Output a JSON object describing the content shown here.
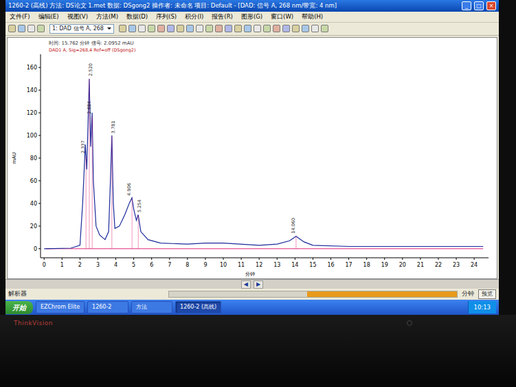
{
  "window": {
    "title": "1260-2 (高线)   方法: DS论文 1.met   数据: DSgong2   操作者: 未命名   项目: Default - [DAD: 信号 A, 268 nm/带宽: 4 nm]",
    "controls": [
      "_",
      "□",
      "×"
    ]
  },
  "menu": [
    "文件(F)",
    "编辑(E)",
    "视图(V)",
    "方法(M)",
    "数据(D)",
    "序列(S)",
    "积分(I)",
    "报告(R)",
    "图形(G)",
    "窗口(W)",
    "帮助(H)"
  ],
  "toolbar": {
    "signal_select": "1: DAD 信号 A, 268"
  },
  "chart": {
    "cursor_readout": "时间: 15.762 分钟   信号: 2.0952 mAU",
    "legend": [
      "DAD1 A, Sig=268,4 Ref=off (DSgong2)"
    ],
    "y_unit": "mAU",
    "x_label": "分钟",
    "y_ticks": [
      "0",
      "20",
      "40",
      "60",
      "80",
      "100",
      "120",
      "140",
      "160"
    ],
    "x_ticks": [
      "0",
      "1",
      "2",
      "3",
      "4",
      "5",
      "6",
      "7",
      "8",
      "9",
      "10",
      "11",
      "12",
      "13",
      "14",
      "15",
      "16",
      "17",
      "18",
      "19",
      "20",
      "21",
      "22",
      "23",
      "24"
    ],
    "series": [
      {
        "name": "DAD1 A",
        "times": [
          0,
          1.5,
          2.0,
          2.15,
          2.3,
          2.38,
          2.45,
          2.52,
          2.6,
          2.68,
          2.75,
          2.9,
          3.1,
          3.4,
          3.6,
          3.7,
          3.78,
          3.86,
          3.95,
          4.2,
          4.5,
          4.75,
          4.9,
          5.0,
          5.15,
          5.25,
          5.4,
          5.8,
          6.5,
          8,
          9,
          10,
          12,
          13,
          13.7,
          14.06,
          14.5,
          15,
          17,
          20,
          24.5
        ],
        "values": [
          0,
          0.5,
          3,
          40,
          92,
          70,
          110,
          150,
          90,
          120,
          60,
          20,
          12,
          8,
          15,
          60,
          100,
          40,
          18,
          20,
          30,
          40,
          45,
          35,
          25,
          30,
          15,
          8,
          5,
          4,
          5,
          5,
          3,
          4,
          7,
          11,
          6,
          3,
          2,
          2,
          2
        ]
      }
    ],
    "peak_labels": [
      "2.337",
      "2.520",
      "2.684",
      "3.781",
      "4.906",
      "5.254",
      "14.060"
    ]
  },
  "scroll": {
    "left": "◀",
    "right": "▶"
  },
  "status_bar": {
    "label": "解析器",
    "progress": {
      "level": 0.52
    },
    "unit": "分钟",
    "button": "预览"
  },
  "taskbar": {
    "start": "开始",
    "items": [
      {
        "label": "EZChrom Elite",
        "selected": false
      },
      {
        "label": "1260-2",
        "selected": false
      },
      {
        "label": "方法",
        "selected": false
      },
      {
        "label": "1260-2 (高线)",
        "selected": true
      }
    ],
    "clock": "10:13"
  },
  "bezel": {
    "brand": "ThinkVision"
  }
}
